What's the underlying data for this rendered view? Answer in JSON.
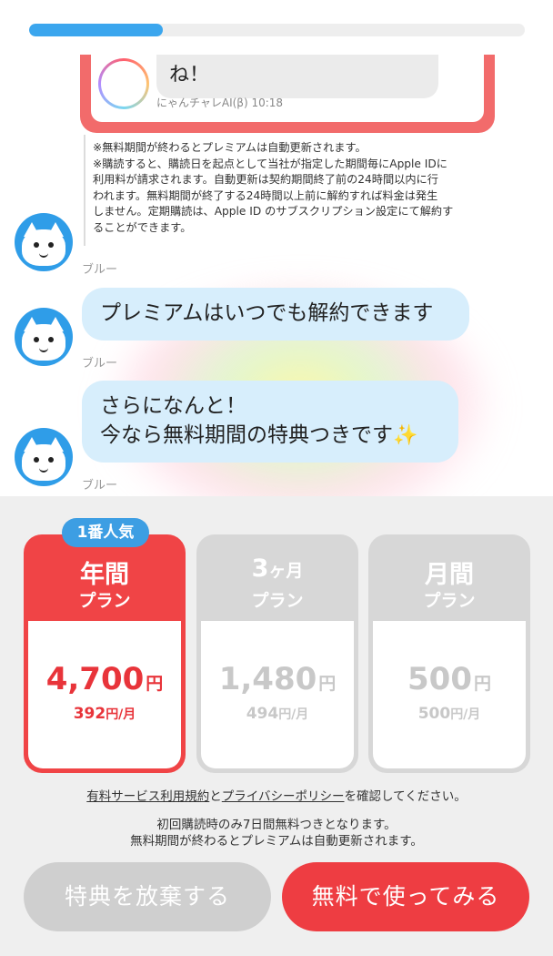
{
  "progress": {
    "fraction": 0.27,
    "color": "#3ba6ee"
  },
  "chat": {
    "preview": {
      "bubble_text": "ね！",
      "sender_time": "にゃんチャレAI(β) 10:18"
    },
    "legal": [
      "※無料期間が終わるとプレミアムは自動更新されます。",
      "※購読すると、購読日を起点として当社が指定した期間毎にApple IDに",
      "利用料が請求されます。自動更新は契約期間終了前の24時間以内に行",
      "われます。無料期間が終了する24時間以上前に解約すれば料金は発生",
      "しません。定期購読は、Apple ID のサブスクリプション設定にて解約す",
      "ることができます。"
    ],
    "messages": [
      {
        "sender": "ブルー",
        "lines": []
      },
      {
        "sender": "ブルー",
        "lines": [
          "プレミアムはいつでも解約できます"
        ]
      },
      {
        "sender": "ブルー",
        "lines": [
          "さらになんと！",
          "今なら無料期間の特典つきです"
        ],
        "emoji": "sparkles"
      }
    ]
  },
  "plans": [
    {
      "badge": "1番人気",
      "title": "年間",
      "sub": "プラン",
      "price": "4,700",
      "price_unit": "円",
      "monthly": "392",
      "monthly_unit": "円/月",
      "selected": true
    },
    {
      "title_num": "3",
      "title_unit": "ヶ月",
      "sub": "プラン",
      "price": "1,480",
      "price_unit": "円",
      "monthly": "494",
      "monthly_unit": "円/月",
      "selected": false
    },
    {
      "title": "月間",
      "sub": "プラン",
      "price": "500",
      "price_unit": "円",
      "monthly": "500",
      "monthly_unit": "円/月",
      "selected": false
    }
  ],
  "terms": {
    "link1": "有料サービス利用規約",
    "and": "と",
    "link2": "プライバシーポリシー",
    "suffix": "を確認してください。"
  },
  "notice": [
    "初回購読時のみ7日間無料つきとなります。",
    "無料期間が終わるとプレミアムは自動更新されます。"
  ],
  "buttons": {
    "decline": "特典を放棄する",
    "trial": "無料で使ってみる"
  },
  "colors": {
    "accent_red": "#ee3d42",
    "badge_blue": "#3d9ee3",
    "bubble_blue": "#d7eefc",
    "disabled_gray": "#cfcfcf"
  }
}
